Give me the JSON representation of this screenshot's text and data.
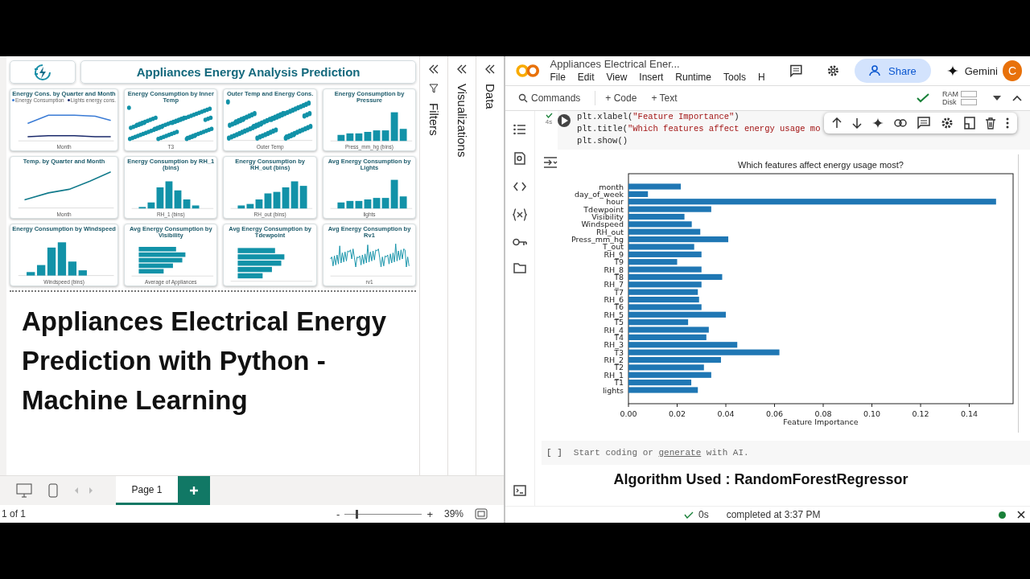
{
  "report": {
    "title": "Appliances Energy Analysis Prediction",
    "visuals": [
      {
        "title": "Energy Cons. by Quarter and Month",
        "xlabel": "Month",
        "kind": "dual_line",
        "legend": [
          "Energy Consumption",
          "Lights energy cons."
        ]
      },
      {
        "title": "Energy Consumption by Inner Temp",
        "xlabel": "T3",
        "kind": "scatter"
      },
      {
        "title": "Outer Temp and Energy Cons.",
        "xlabel": "Outer Temp",
        "kind": "scatter"
      },
      {
        "title": "Energy Consumption by Pressure",
        "xlabel": "Press_mm_hg (bins)",
        "kind": "bar"
      },
      {
        "title": "Temp. by Quarter and Month",
        "xlabel": "Month",
        "kind": "line"
      },
      {
        "title": "Energy Consumption by RH_1 (bins)",
        "xlabel": "RH_1 (bins)",
        "kind": "bar"
      },
      {
        "title": "Energy Consumption by RH_out (bins)",
        "xlabel": "RH_out (bins)",
        "kind": "bar"
      },
      {
        "title": "Avg Energy Consumption by Lights",
        "xlabel": "lights",
        "kind": "bar"
      },
      {
        "title": "Energy Consumption by Windspeed",
        "xlabel": "Windspeed (bins)",
        "kind": "bar"
      },
      {
        "title": "Avg Energy Consumption by Visibility",
        "xlabel": "Average of Appliances",
        "kind": "hbar"
      },
      {
        "title": "Avg Energy Consumption by Tdewpoint",
        "kind": "hbar"
      },
      {
        "title": "Avg Energy Consumption by Rv1",
        "xlabel": "rv1",
        "kind": "spiky"
      }
    ],
    "caption_lines": [
      "Appliances Electrical Energy",
      "Prediction with Python -",
      "Machine Learning"
    ]
  },
  "panes": [
    {
      "label": "Filters",
      "kind": "filters"
    },
    {
      "label": "Visualizations",
      "kind": "plain"
    },
    {
      "label": "Data",
      "kind": "plain"
    }
  ],
  "page_tabs": [
    {
      "label": "Page 1",
      "selected": true
    }
  ],
  "report_status": {
    "page": "1 of 1",
    "zoom": "39%",
    "zoom_minus": "-",
    "zoom_plus": "+",
    "level": 0.14
  },
  "notebook": {
    "title": "Appliances Electrical Ener...",
    "menu": [
      "File",
      "Edit",
      "View",
      "Insert",
      "Runtime",
      "Tools",
      "H"
    ],
    "share": "Share",
    "gemini": "Gemini",
    "avatar": "C",
    "toolbar": {
      "commands": "Commands",
      "code": "+ Code",
      "text": "+ Text",
      "ram": "RAM",
      "disk": "Disk"
    },
    "cell": {
      "exec_time": "4s",
      "code_lines": [
        [
          {
            "text": "plt.xlabel(",
            "kind": "plain"
          },
          {
            "text": "\"Feature Importance\"",
            "kind": "string"
          },
          {
            "text": ")",
            "kind": "plain"
          }
        ],
        [
          {
            "text": "plt.title(",
            "kind": "plain"
          },
          {
            "text": "\"Which features affect energy usage mo",
            "kind": "string"
          }
        ],
        [
          {
            "text": "plt.show()",
            "kind": "plain"
          }
        ]
      ]
    },
    "chart_data": {
      "type": "bar",
      "orientation": "horizontal",
      "title": "Which features affect energy usage most?",
      "xlabel": "Feature Importance",
      "categories": [
        "month",
        "day_of_week",
        "hour",
        "Tdewpoint",
        "Visibility",
        "Windspeed",
        "RH_out",
        "Press_mm_hg",
        "T_out",
        "RH_9",
        "T9",
        "RH_8",
        "T8",
        "RH_7",
        "T7",
        "RH_6",
        "T6",
        "RH_5",
        "T5",
        "RH_4",
        "T4",
        "RH_3",
        "T3",
        "RH_2",
        "T2",
        "RH_1",
        "T1",
        "lights"
      ],
      "values": [
        0.0215,
        0.008,
        0.151,
        0.034,
        0.023,
        0.026,
        0.0295,
        0.041,
        0.027,
        0.03,
        0.02,
        0.03,
        0.0385,
        0.03,
        0.0285,
        0.029,
        0.03,
        0.04,
        0.0245,
        0.033,
        0.032,
        0.0447,
        0.062,
        0.038,
        0.031,
        0.034,
        0.0258,
        0.0285
      ],
      "xlim": [
        0,
        0.158
      ],
      "xticks": [
        {
          "value": 0,
          "label": "0.00"
        },
        {
          "value": 0.02,
          "label": "0.02"
        },
        {
          "value": 0.04,
          "label": "0.04"
        },
        {
          "value": 0.06,
          "label": "0.06"
        },
        {
          "value": 0.08,
          "label": "0.08"
        },
        {
          "value": 0.1,
          "label": "0.10"
        },
        {
          "value": 0.12,
          "label": "0.12"
        },
        {
          "value": 0.14,
          "label": "0.14"
        }
      ]
    },
    "empty_cell": {
      "brackets": "[ ]",
      "prompt_before": "Start coding or ",
      "prompt_link": "generate",
      "prompt_after": " with AI."
    },
    "heading": "Algorithm Used :  RandomForestRegressor",
    "status": {
      "elapsed": "0s",
      "message": "completed at 3:37 PM"
    }
  }
}
